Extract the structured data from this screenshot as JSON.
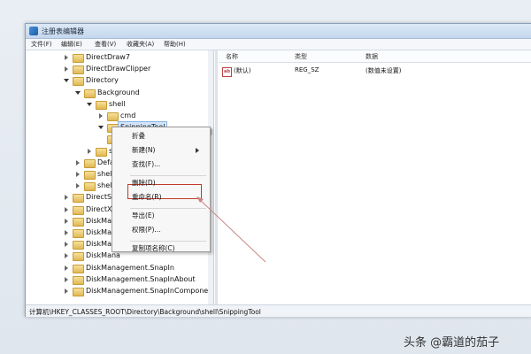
{
  "window": {
    "title": "注册表编辑器"
  },
  "menubar": [
    "文件(F)",
    "编辑(E)",
    "查看(V)",
    "收藏夹(A)",
    "帮助(H)"
  ],
  "tree": [
    {
      "label": "DirectDraw7",
      "toggle": "collapsed",
      "indent": 0
    },
    {
      "label": "DirectDrawClipper",
      "toggle": "collapsed",
      "indent": 0
    },
    {
      "label": "Directory",
      "toggle": "expanded",
      "indent": 0
    },
    {
      "label": "Background",
      "toggle": "expanded",
      "indent": 1
    },
    {
      "label": "shell",
      "toggle": "expanded",
      "indent": 2
    },
    {
      "label": "cmd",
      "toggle": "collapsed",
      "indent": 3
    },
    {
      "label": "SnippingTool",
      "toggle": "expanded",
      "indent": 3,
      "selected": true
    },
    {
      "label": "",
      "toggle": "none",
      "indent": 3
    },
    {
      "label": "she",
      "toggle": "collapsed",
      "indent": 2
    },
    {
      "label": "Defau",
      "toggle": "collapsed",
      "indent": 1
    },
    {
      "label": "shell",
      "toggle": "collapsed",
      "indent": 1
    },
    {
      "label": "shelle",
      "toggle": "collapsed",
      "indent": 1
    },
    {
      "label": "DirectSho",
      "toggle": "collapsed",
      "indent": 0
    },
    {
      "label": "DirectXFil",
      "toggle": "collapsed",
      "indent": 0
    },
    {
      "label": "DiskMana",
      "toggle": "collapsed",
      "indent": 0
    },
    {
      "label": "DiskMana",
      "toggle": "collapsed",
      "indent": 0
    },
    {
      "label": "DiskMana",
      "toggle": "collapsed",
      "indent": 0
    },
    {
      "label": "DiskMana",
      "toggle": "collapsed",
      "indent": 0
    },
    {
      "label": "DiskManagement.SnapIn",
      "toggle": "collapsed",
      "indent": 0
    },
    {
      "label": "DiskManagement.SnapInAbout",
      "toggle": "collapsed",
      "indent": 0
    },
    {
      "label": "DiskManagement.SnapInComponent",
      "toggle": "collapsed",
      "indent": 0
    }
  ],
  "list": {
    "columns": [
      "名称",
      "类型",
      "数据"
    ],
    "rows": [
      {
        "name": "(默认)",
        "type": "REG_SZ",
        "data": "(数值未设置)",
        "icon": "ab-value-icon"
      }
    ]
  },
  "context_menu": {
    "items": [
      {
        "label": "折叠",
        "kind": "item"
      },
      {
        "label": "新建(N)",
        "kind": "item",
        "submenu": true
      },
      {
        "label": "查找(F)...",
        "kind": "item"
      },
      {
        "kind": "separator"
      },
      {
        "label": "删除(D)",
        "kind": "item"
      },
      {
        "label": "重命名(R)",
        "kind": "item",
        "highlighted": true
      },
      {
        "kind": "separator"
      },
      {
        "label": "导出(E)",
        "kind": "item"
      },
      {
        "label": "权限(P)...",
        "kind": "item"
      },
      {
        "kind": "separator"
      },
      {
        "label": "复制项名称(C)",
        "kind": "item"
      }
    ]
  },
  "status": {
    "path": "计算机\\HKEY_CLASSES_ROOT\\Directory\\Background\\shell\\SnippingTool"
  },
  "watermark": "头条 @霸道的茄子",
  "colors": {
    "highlight_box": "#c0392b",
    "selection": "#d3e5fa"
  }
}
